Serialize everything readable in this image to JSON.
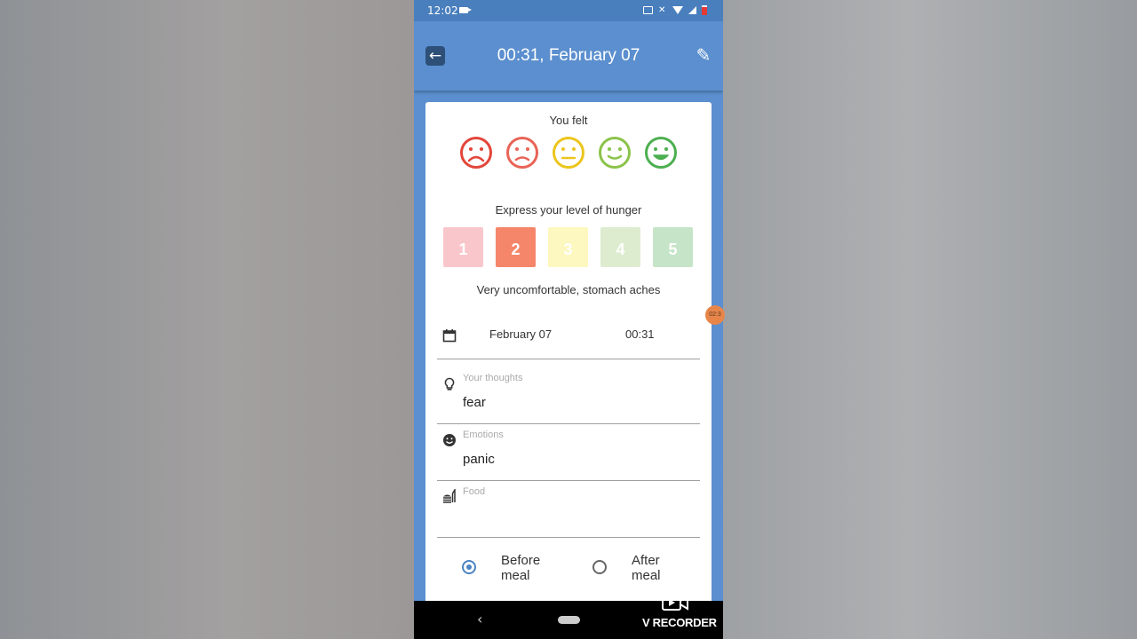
{
  "status_bar": {
    "time": "12:02"
  },
  "app_bar": {
    "title": "00:31, February 07"
  },
  "mood": {
    "label": "You felt",
    "faces": [
      {
        "icon": "very-sad-face-icon",
        "color": "#e2463a"
      },
      {
        "icon": "sad-face-icon",
        "color": "#e86456"
      },
      {
        "icon": "neutral-face-icon",
        "color": "#ecc51d"
      },
      {
        "icon": "smile-face-icon",
        "color": "#8bc34a"
      },
      {
        "icon": "happy-face-icon",
        "color": "#4caf50"
      }
    ]
  },
  "hunger": {
    "label": "Express your level of hunger",
    "levels": [
      {
        "value": "1",
        "color": "#f9c6cb"
      },
      {
        "value": "2",
        "color": "#f5866a"
      },
      {
        "value": "3",
        "color": "#fcf8bf"
      },
      {
        "value": "4",
        "color": "#ddeccf"
      },
      {
        "value": "5",
        "color": "#c6e5c8"
      }
    ],
    "selected": "2",
    "description": "Very uncomfortable, stomach aches"
  },
  "datetime": {
    "date": "February 07",
    "time": "00:31"
  },
  "thoughts": {
    "label": "Your thoughts",
    "value": "fear"
  },
  "emotions": {
    "label": "Emotions",
    "value": "panic"
  },
  "food": {
    "label": "Food",
    "value": ""
  },
  "meal_timing": {
    "before_label": "Before meal",
    "after_label": "After meal",
    "selected": "before"
  },
  "overlay": {
    "bubble_text": "02:3",
    "watermark": "V RECORDER"
  }
}
